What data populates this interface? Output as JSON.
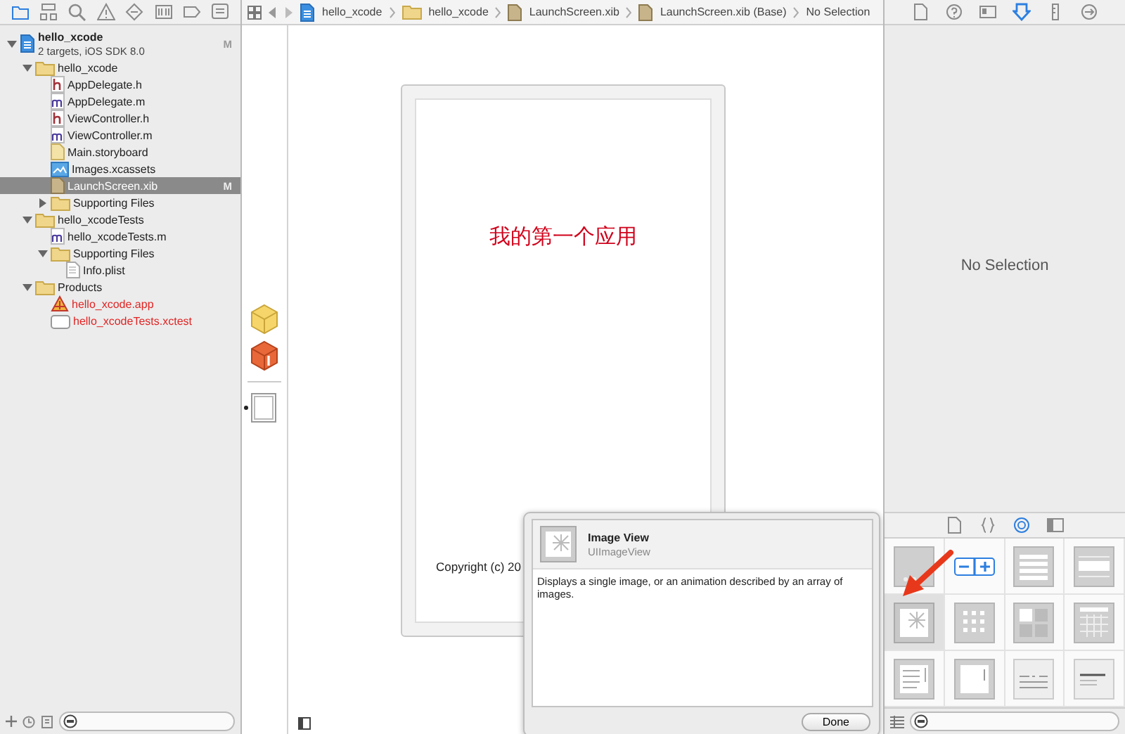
{
  "navigator": {
    "tabs": [
      {
        "kind": "folder",
        "selected": true
      },
      {
        "kind": "hierarchy",
        "selected": false
      },
      {
        "kind": "search",
        "selected": false
      },
      {
        "kind": "warning",
        "selected": false
      },
      {
        "kind": "test",
        "selected": false
      },
      {
        "kind": "debug",
        "selected": false
      },
      {
        "kind": "breakpoint",
        "selected": false
      },
      {
        "kind": "log",
        "selected": false
      }
    ],
    "tree": [
      {
        "kind": "project",
        "name": "hello_xcode",
        "subtitle": "2 targets, iOS SDK 8.0",
        "badge": "M",
        "selected": false,
        "missing": false,
        "expanded": true,
        "children": [
          {
            "kind": "folder",
            "name": "hello_xcode",
            "selected": false,
            "missing": false,
            "expanded": true,
            "children": [
              {
                "kind": "h",
                "name": "AppDelegate.h",
                "selected": false,
                "missing": false
              },
              {
                "kind": "m",
                "name": "AppDelegate.m",
                "selected": false,
                "missing": false
              },
              {
                "kind": "h",
                "name": "ViewController.h",
                "selected": false,
                "missing": false
              },
              {
                "kind": "m",
                "name": "ViewController.m",
                "selected": false,
                "missing": false
              },
              {
                "kind": "storyboard",
                "name": "Main.storyboard",
                "selected": false,
                "missing": false
              },
              {
                "kind": "assets",
                "name": "Images.xcassets",
                "selected": false,
                "missing": false
              },
              {
                "kind": "xib",
                "name": "LaunchScreen.xib",
                "badge": "M",
                "selected": true,
                "missing": false
              },
              {
                "kind": "folder",
                "name": "Supporting Files",
                "selected": false,
                "missing": false,
                "expanded": false
              }
            ]
          },
          {
            "kind": "folder",
            "name": "hello_xcodeTests",
            "selected": false,
            "missing": false,
            "expanded": true,
            "children": [
              {
                "kind": "m",
                "name": "hello_xcodeTests.m",
                "selected": false,
                "missing": false
              },
              {
                "kind": "folder",
                "name": "Supporting Files",
                "selected": false,
                "missing": false,
                "expanded": true,
                "children": [
                  {
                    "kind": "plist",
                    "name": "Info.plist",
                    "selected": false,
                    "missing": false
                  }
                ]
              }
            ]
          },
          {
            "kind": "folder",
            "name": "Products",
            "selected": false,
            "missing": false,
            "expanded": true,
            "children": [
              {
                "kind": "app",
                "name": "hello_xcode.app",
                "selected": false,
                "missing": true
              },
              {
                "kind": "xctest",
                "name": "hello_xcodeTests.xctest",
                "selected": false,
                "missing": true
              }
            ]
          }
        ]
      }
    ]
  },
  "jump_bar": [
    {
      "kind": "project",
      "label": "hello_xcode"
    },
    {
      "kind": "folder",
      "label": "hello_xcode"
    },
    {
      "kind": "xib",
      "label": "LaunchScreen.xib"
    },
    {
      "kind": "xib",
      "label": "LaunchScreen.xib (Base)"
    },
    {
      "kind": "none",
      "label": "No Selection"
    }
  ],
  "canvas": {
    "title": "我的第一个应用",
    "footer": "Copyright (c) 20"
  },
  "inspector": {
    "tabs": [
      {
        "kind": "file",
        "selected": false
      },
      {
        "kind": "help",
        "selected": false
      },
      {
        "kind": "identity",
        "selected": false
      },
      {
        "kind": "attributes",
        "selected": true
      },
      {
        "kind": "size",
        "selected": false
      },
      {
        "kind": "connections",
        "selected": false
      }
    ],
    "empty_text": "No Selection"
  },
  "library": {
    "tabs": [
      {
        "kind": "file",
        "selected": false
      },
      {
        "kind": "code",
        "selected": false
      },
      {
        "kind": "object",
        "selected": true
      },
      {
        "kind": "media",
        "selected": false
      }
    ],
    "items": [
      {
        "kind": "page",
        "selected": false
      },
      {
        "kind": "stepper",
        "selected": false
      },
      {
        "kind": "table",
        "selected": false
      },
      {
        "kind": "table-cell",
        "selected": false
      },
      {
        "kind": "image",
        "selected": true
      },
      {
        "kind": "collection",
        "selected": false
      },
      {
        "kind": "collection-cell",
        "selected": false
      },
      {
        "kind": "collection-controller",
        "selected": false
      },
      {
        "kind": "text",
        "selected": false
      },
      {
        "kind": "scroll",
        "selected": false
      },
      {
        "kind": "date",
        "selected": false
      },
      {
        "kind": "textview",
        "selected": false
      }
    ]
  },
  "popover": {
    "title": "Image View",
    "class_name": "UIImageView",
    "description": "Displays a single image, or an animation described by an array of images.",
    "button": "Done"
  }
}
